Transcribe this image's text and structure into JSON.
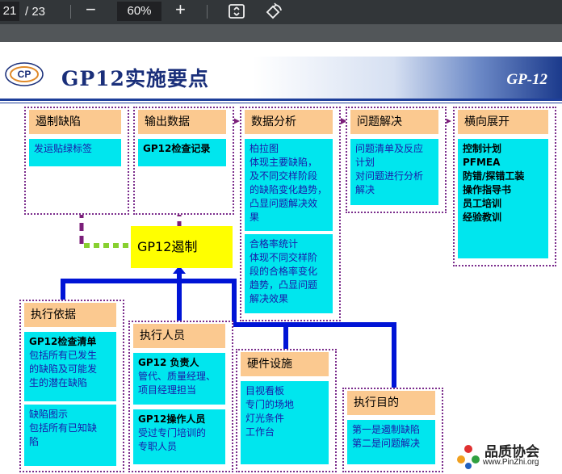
{
  "toolbar": {
    "page_current": "21",
    "page_total": "/ 23",
    "zoom_out": "−",
    "zoom_value": "60%",
    "zoom_in": "+",
    "fit_icon": "fit-page-icon",
    "rotate_icon": "rotate-icon"
  },
  "slide": {
    "title": "GP12实施要点",
    "tag": "GP-12",
    "center_label": "GP12遏制",
    "boxes": {
      "containment": {
        "header": "遏制缺陷",
        "lines": [
          "发运贴绿标签"
        ]
      },
      "output": {
        "header": "输出数据",
        "lines": [
          "GP12检查记录"
        ]
      },
      "analysis": {
        "header": "数据分析",
        "section1": [
          "柏拉图",
          "体现主要缺陷，",
          "及不同交样阶段",
          "的缺陷变化趋势，",
          "凸显问题解决效",
          "果"
        ],
        "section2": [
          "合格率统计",
          "体现不同交样阶",
          "段的合格率变化",
          "趋势，凸显问题",
          "解决效果"
        ]
      },
      "problem": {
        "header": "问题解决",
        "lines": [
          "问题清单及反应",
          "计划",
          "对问题进行分析",
          "解决"
        ]
      },
      "expand": {
        "header": "横向展开",
        "lines": [
          "控制计划",
          "PFMEA",
          "防错/探错工装",
          "操作指导书",
          "员工培训",
          "经验教训"
        ]
      },
      "basis": {
        "header": "执行依据",
        "section1_title": "GP12检查清单",
        "section1": [
          "包括所有已发生",
          "的缺陷及可能发",
          "生的潜在缺陷"
        ],
        "section2": [
          "缺陷图示",
          "包括所有已知缺",
          "陷"
        ]
      },
      "staff": {
        "header": "执行人员",
        "section1_title": "GP12 负责人",
        "section1": [
          "管代、质量经理、",
          "项目经理担当"
        ],
        "section2_title": "GP12操作人员",
        "section2": [
          "受过专门培训的",
          "专职人员"
        ]
      },
      "hardware": {
        "header": "硬件设施",
        "lines": [
          "目视看板",
          "专门的场地",
          "灯光条件",
          "工作台"
        ]
      },
      "purpose": {
        "header": "执行目的",
        "lines": [
          "第一是遏制缺陷",
          "第二是问题解决"
        ]
      }
    },
    "watermark": {
      "name": "品质协会",
      "url": "www.PinZhi.org"
    }
  },
  "colors": {
    "header_fill": "#fbc990",
    "body_fill": "#00e6ee",
    "body_text": "#1a1aa8",
    "arrow_purple": "#7b1f7a",
    "connector_blue": "#0014d6",
    "center_fill": "#ffff00",
    "title_color": "#1a2f7a"
  }
}
